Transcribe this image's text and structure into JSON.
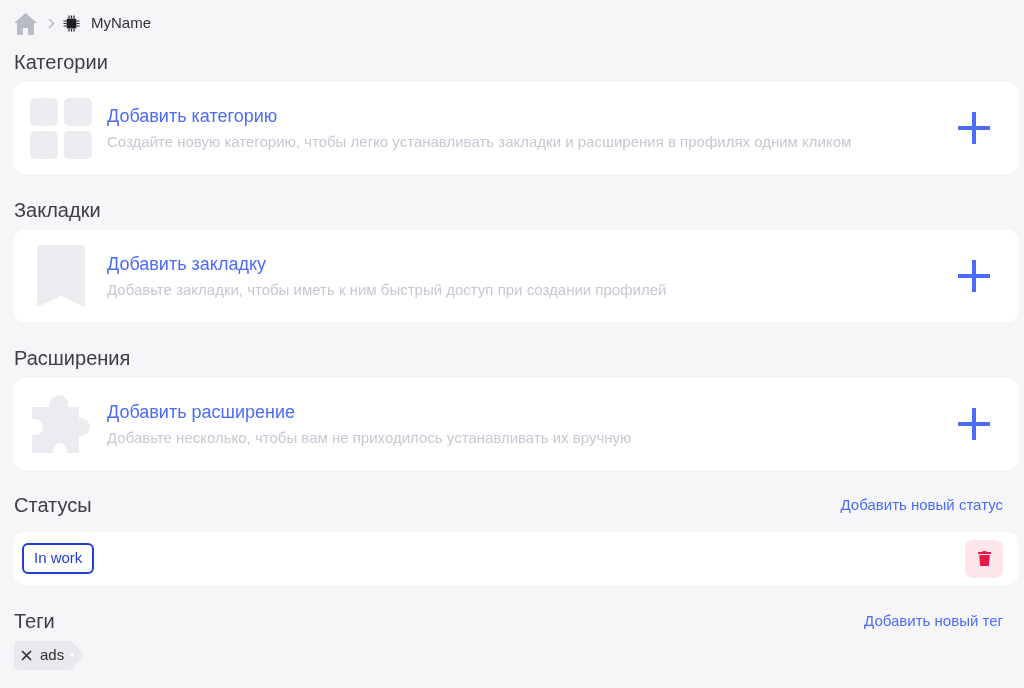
{
  "breadcrumb": {
    "current": "MyName"
  },
  "sections": [
    {
      "kind": "categories",
      "heading": "Категории",
      "title": "Добавить категорию",
      "description": "Создайте новую категорию, чтобы легко устанавливать закладки и расширения в профилях одним кликом"
    },
    {
      "kind": "bookmarks",
      "heading": "Закладки",
      "title": "Добавить закладку",
      "description": "Добавьте закладки, чтобы иметь к ним быстрый доступ при создании профилей"
    },
    {
      "kind": "extensions",
      "heading": "Расширения",
      "title": "Добавить расширение",
      "description": "Добавьте несколько, чтобы вам не приходилось устанавливать их вручную"
    }
  ],
  "statuses": {
    "heading": "Статусы",
    "add_link": "Добавить новый статус",
    "items": [
      {
        "label": "In work",
        "color": "#1f3fd0"
      }
    ]
  },
  "tags": {
    "heading": "Теги",
    "add_link": "Добавить новый тег",
    "items": [
      {
        "label": "ads"
      }
    ]
  }
}
